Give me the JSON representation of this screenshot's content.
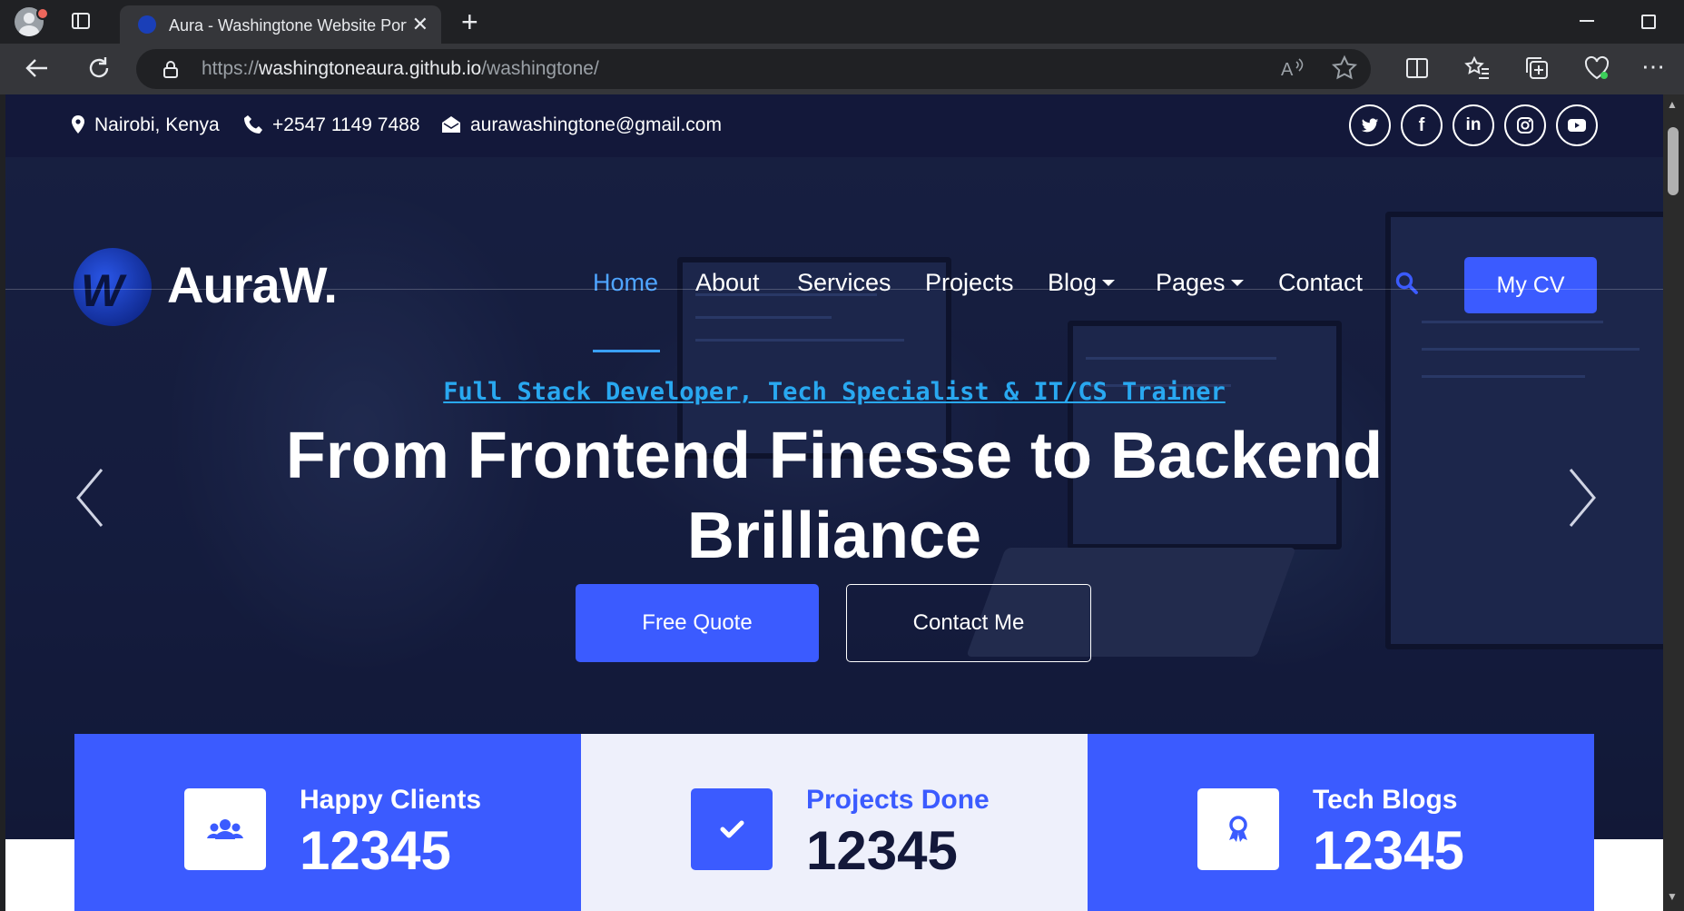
{
  "browser": {
    "tab_title": "Aura - Washingtone Website Portfolio",
    "url_scheme": "https://",
    "url_host": "washingtoneaura.github.io",
    "url_path": "/washingtone/"
  },
  "topbar": {
    "location": "Nairobi, Kenya",
    "phone": "+2547 1149 7488",
    "email": "aurawashingtone@gmail.com",
    "socials": [
      "twitter-icon",
      "facebook-icon",
      "linkedin-icon",
      "instagram-icon",
      "youtube-icon"
    ]
  },
  "navbar": {
    "brand": "AuraW.",
    "links": [
      "Home",
      "About",
      "Services",
      "Projects",
      "Blog",
      "Pages",
      "Contact"
    ],
    "active": "Home",
    "cv_button": "My CV"
  },
  "hero": {
    "eyebrow": "Full Stack Developer, Tech Specialist & IT/CS Trainer",
    "headline": "From Frontend Finesse to Backend Brilliance",
    "primary_button": "Free Quote",
    "secondary_button": "Contact Me"
  },
  "stats": [
    {
      "label": "Happy Clients",
      "value": "12345",
      "icon": "users-icon"
    },
    {
      "label": "Projects Done",
      "value": "12345",
      "icon": "check-icon"
    },
    {
      "label": "Tech Blogs",
      "value": "12345",
      "icon": "award-icon"
    }
  ],
  "colors": {
    "accent": "#3b5bff",
    "topbar": "#13183a",
    "eyebrow": "#29a8f0",
    "active_link": "#4ea4ff"
  }
}
